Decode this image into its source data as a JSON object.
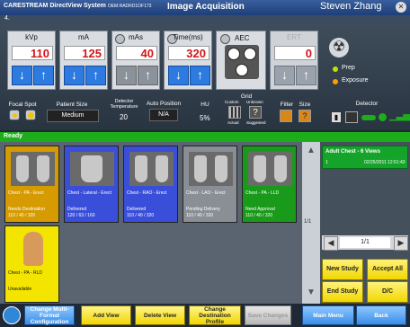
{
  "titlebar": {
    "brand": "CARESTREAM",
    "system": "DirectView System",
    "system_id": "OEM:RADRD1OF173",
    "title": "Image Acquisition",
    "user": "Steven Zhang"
  },
  "tab": {
    "label": "4."
  },
  "params": [
    {
      "label": "kVp",
      "value": "110"
    },
    {
      "label": "mA",
      "value": "125"
    },
    {
      "label": "mAs",
      "value": "40"
    },
    {
      "label": "Time(ms)",
      "value": "320"
    }
  ],
  "aec": {
    "label": "AEC"
  },
  "ert": {
    "label": "ERT",
    "value": "0"
  },
  "status": {
    "prep": "Prep",
    "exposure": "Exposure"
  },
  "settings": {
    "focal_spot": "Focal Spot",
    "patient_size": "Patient Size",
    "patient_size_value": "Medium",
    "detector_temp": "Detector Temperature",
    "detector_temp_value": "20",
    "auto_position": "Auto Position",
    "auto_position_value": "N/A",
    "hu": "HU",
    "hu_value": "5%",
    "grid": "Grid",
    "grid_custom": "Custom",
    "grid_unknown": "Unknown",
    "grid_actual": "Actual",
    "grid_suggested": "Suggested",
    "filter": "Filter",
    "size": "Size",
    "detector": "Detector"
  },
  "ready": "Ready",
  "thumbs": [
    {
      "name": "Chest - PA - Erect",
      "status": "Needs Destination",
      "params": "110 / 40 / 320",
      "color": "#d59b00"
    },
    {
      "name": "Chest - Lateral - Erect",
      "status": "Delivered",
      "params": "120 / 63 / 160",
      "color": "#3a4fd9"
    },
    {
      "name": "Chest - RAO - Erect",
      "status": "Delivered",
      "params": "110 / 40 / 320",
      "color": "#3a4fd9"
    },
    {
      "name": "Chest - LAO - Erect",
      "status": "Pending Delivery",
      "params": "110 / 40 / 320",
      "color": "#8a8f96"
    },
    {
      "name": "Chest - PA - LLD",
      "status": "Need Approval",
      "params": "110 / 40 / 320",
      "color": "#1a9a1a"
    },
    {
      "name": "Chest - PA - RLD",
      "status": "Unavailable",
      "params": "",
      "color": "#f3e500"
    }
  ],
  "thumb_page": "1/1",
  "study": {
    "title": "Adult Chest - 6 Views",
    "count": "1",
    "date": "02/25/2011 12:51:43"
  },
  "pager": "1/1",
  "right_buttons": {
    "new_study": "New Study",
    "accept_all": "Accept All",
    "end_study": "End Study",
    "dc": "D/C"
  },
  "bottom": {
    "change_config": "Change Multi-Format Configuration",
    "add_view": "Add View",
    "delete_view": "Delete View",
    "change_dest": "Change Destination Profile",
    "save_changes": "Save Changes",
    "main_menu": "Main Menu",
    "back": "Back"
  },
  "colors": {
    "ready": "#1dad1a",
    "value_red": "#d4151a",
    "arrow_blue": "#2d7be0",
    "yellow": "#f2d600"
  }
}
